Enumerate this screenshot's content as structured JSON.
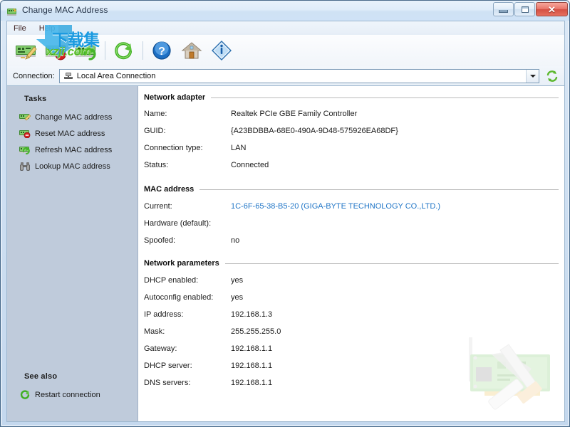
{
  "window": {
    "title": "Change MAC Address",
    "title_icon": "app-network-card-icon",
    "buttons": {
      "minimize": "Minimize",
      "maximize": "Maximize",
      "close": "Close",
      "close_glyph": "✕"
    }
  },
  "menu": {
    "items": [
      {
        "label": "File",
        "name": "menu-file"
      },
      {
        "label": "Help",
        "name": "menu-help"
      }
    ]
  },
  "toolbar": {
    "buttons": [
      {
        "name": "toolbar-change-mac-address",
        "icon": "network-card-pencil-icon",
        "title": "Change MAC address"
      },
      {
        "name": "toolbar-reset-mac-address",
        "icon": "network-card-deny-icon",
        "title": "Reset MAC address"
      },
      {
        "name": "toolbar-refresh-mac-address",
        "icon": "network-card-refresh-icon",
        "title": "Refresh MAC address"
      },
      {
        "name": "toolbar-restart-connection",
        "icon": "green-circular-refresh-icon",
        "title": "Restart connection"
      },
      {
        "name": "toolbar-help",
        "icon": "blue-question-mark-icon",
        "title": "Help"
      },
      {
        "name": "toolbar-home",
        "icon": "house-icon",
        "title": "Home page"
      },
      {
        "name": "toolbar-about",
        "icon": "blue-info-diamond-icon",
        "title": "About"
      }
    ]
  },
  "connection": {
    "label": "Connection:",
    "selected": "Local Area Connection",
    "selected_icon": "network-connection-icon",
    "dropdown_icon": "chevron-down-icon",
    "refresh_icon": "green-double-arrow-refresh-icon"
  },
  "sidebar": {
    "tasks_heading": "Tasks",
    "tasks": [
      {
        "label": "Change MAC address",
        "icon": "network-card-pencil-icon",
        "name": "sidebar-item-change-mac-address"
      },
      {
        "label": "Reset MAC address",
        "icon": "network-card-deny-icon",
        "name": "sidebar-item-reset-mac-address"
      },
      {
        "label": "Refresh MAC address",
        "icon": "network-card-refresh-icon",
        "name": "sidebar-item-refresh-mac-address"
      },
      {
        "label": "Lookup MAC address",
        "icon": "binoculars-icon",
        "name": "sidebar-item-lookup-mac-address"
      }
    ],
    "seealso_heading": "See also",
    "seealso": [
      {
        "label": "Restart connection",
        "icon": "green-circular-refresh-icon",
        "name": "sidebar-item-restart-connection"
      }
    ]
  },
  "content": {
    "sections": [
      {
        "title": "Network adapter",
        "rows": [
          {
            "key": "Name:",
            "value": "Realtek PCIe GBE Family Controller",
            "link": false
          },
          {
            "key": "GUID:",
            "value": "{A23BDBBA-68E0-490A-9D48-575926EA68DF}",
            "link": false
          },
          {
            "key": "Connection type:",
            "value": "LAN",
            "link": false
          },
          {
            "key": "Status:",
            "value": "Connected",
            "link": false
          }
        ]
      },
      {
        "title": "MAC address",
        "rows": [
          {
            "key": "Current:",
            "value": "1C-6F-65-38-B5-20 (GIGA-BYTE TECHNOLOGY CO.,LTD.)",
            "link": true
          },
          {
            "key": "Hardware (default):",
            "value": "",
            "link": false
          },
          {
            "key": "Spoofed:",
            "value": "no",
            "link": false
          }
        ]
      },
      {
        "title": "Network parameters",
        "rows": [
          {
            "key": "DHCP enabled:",
            "value": "yes",
            "link": false
          },
          {
            "key": "Autoconfig enabled:",
            "value": "yes",
            "link": false
          },
          {
            "key": "IP address:",
            "value": "192.168.1.3",
            "link": false
          },
          {
            "key": "Mask:",
            "value": "255.255.255.0",
            "link": false
          },
          {
            "key": "Gateway:",
            "value": "192.168.1.1",
            "link": false
          },
          {
            "key": "DHCP server:",
            "value": "192.168.1.1",
            "link": false
          },
          {
            "key": "DNS servers:",
            "value": "192.168.1.1",
            "link": false
          }
        ]
      }
    ],
    "background_illustration": "network-card-tools-watermark"
  },
  "watermark": {
    "cn_text": "下载集",
    "domain_text": "xzji.com",
    "arrow_icon": "blue-download-arrow-icon"
  },
  "colors": {
    "link": "#2176c7",
    "sidebar_bg": "#bfcbdb",
    "accent_green": "#5bbf2a",
    "accent_blue": "#1a9ae0",
    "window_border": "#4a6b8a"
  }
}
